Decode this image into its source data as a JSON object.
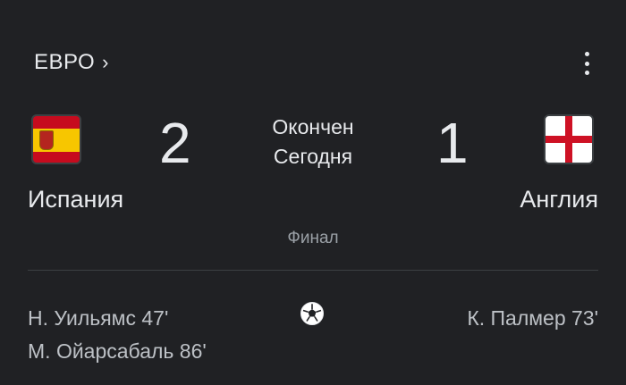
{
  "header": {
    "competition": "ЕВРО",
    "chevron_icon": "chevron-right-icon",
    "menu_icon": "more-vert-icon"
  },
  "match": {
    "home": {
      "name": "Испания",
      "score": "2",
      "flag": "spain-flag-icon"
    },
    "away": {
      "name": "Англия",
      "score": "1",
      "flag": "england-flag-icon"
    },
    "status": "Окончен",
    "date": "Сегодня",
    "round": "Финал"
  },
  "goals": {
    "home": [
      "Н. Уильямс 47'",
      "М. Ойарсабаль 86'"
    ],
    "away": [
      "К. Палмер 73'"
    ],
    "icon": "soccer-ball-icon"
  },
  "colors": {
    "background": "#202124",
    "text_primary": "#e8eaed",
    "text_secondary": "#9aa0a6",
    "divider": "#3c4043"
  }
}
